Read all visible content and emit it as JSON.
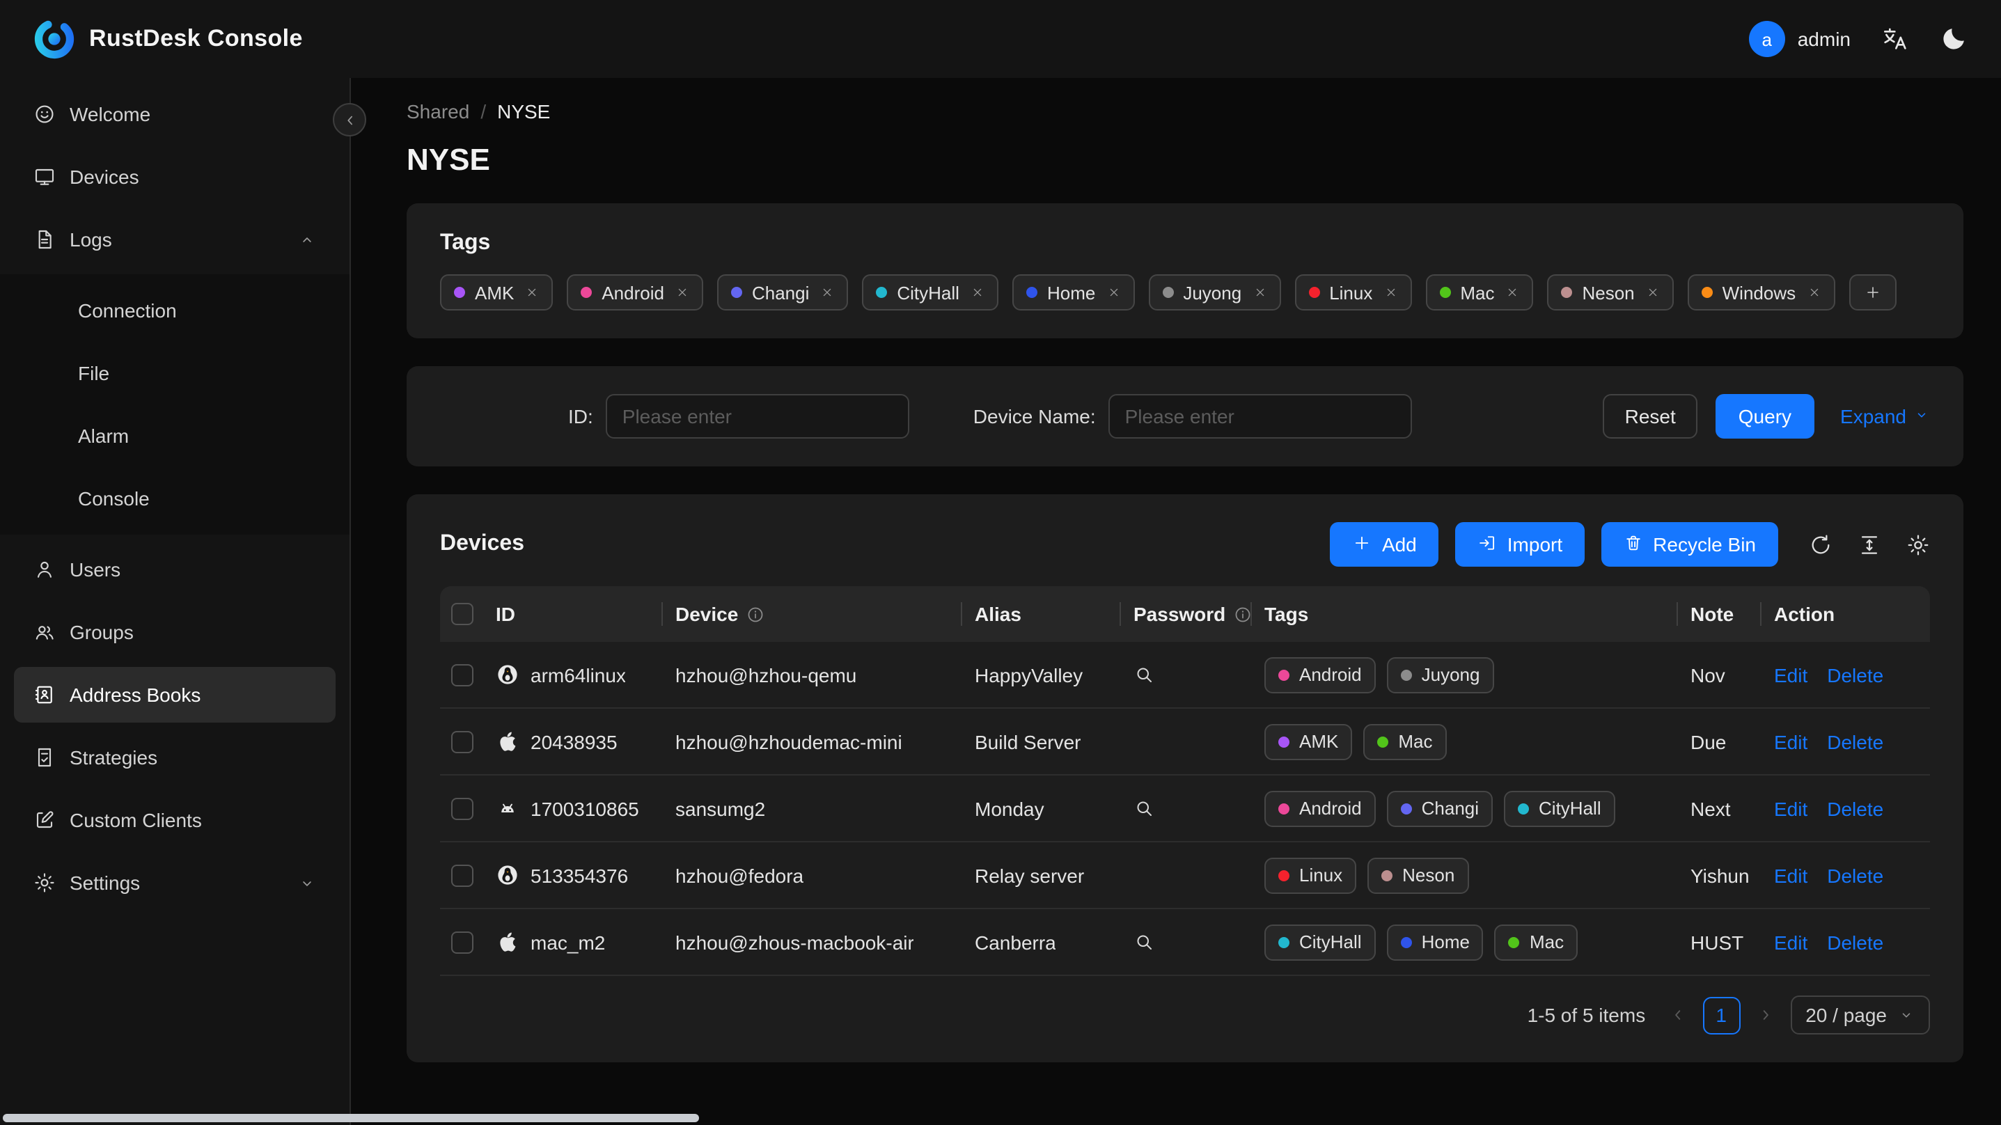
{
  "theme": {
    "accent_color": "#1677ff",
    "card_bg": "#1d1d1d",
    "page_bg": "#0a0a0a",
    "bar_bg": "#141414"
  },
  "header": {
    "app_title": "RustDesk Console",
    "user_initial": "a",
    "user_name": "admin"
  },
  "sidebar": {
    "items": [
      {
        "id": "welcome",
        "label": "Welcome",
        "icon": "smile-icon"
      },
      {
        "id": "devices",
        "label": "Devices",
        "icon": "desktop-icon"
      },
      {
        "id": "logs",
        "label": "Logs",
        "icon": "file-text-icon",
        "expanded": true,
        "children": [
          {
            "id": "connection",
            "label": "Connection"
          },
          {
            "id": "file",
            "label": "File"
          },
          {
            "id": "alarm",
            "label": "Alarm"
          },
          {
            "id": "console",
            "label": "Console"
          }
        ]
      },
      {
        "id": "users",
        "label": "Users",
        "icon": "user-icon"
      },
      {
        "id": "groups",
        "label": "Groups",
        "icon": "team-icon"
      },
      {
        "id": "address-books",
        "label": "Address Books",
        "icon": "contacts-icon",
        "active": true
      },
      {
        "id": "strategies",
        "label": "Strategies",
        "icon": "strategy-icon"
      },
      {
        "id": "custom-clients",
        "label": "Custom Clients",
        "icon": "form-icon"
      },
      {
        "id": "settings",
        "label": "Settings",
        "icon": "gear-icon",
        "collapsible": true
      }
    ]
  },
  "breadcrumb": {
    "parent": "Shared",
    "separator": "/",
    "current": "NYSE"
  },
  "page_title": "NYSE",
  "tag_colors": {
    "AMK": "#a855f7",
    "Android": "#ec4899",
    "Changi": "#6366f1",
    "CityHall": "#22b8cf",
    "Home": "#2f54eb",
    "Juyong": "#8c8c8c",
    "Linux": "#f5222d",
    "Mac": "#52c41a",
    "Neson": "#bc8f8f",
    "Windows": "#fa8c16"
  },
  "tags_card": {
    "title": "Tags",
    "tags": [
      "AMK",
      "Android",
      "Changi",
      "CityHall",
      "Home",
      "Juyong",
      "Linux",
      "Mac",
      "Neson",
      "Windows"
    ]
  },
  "filter": {
    "id_label": "ID:",
    "id_placeholder": "Please enter",
    "name_label": "Device Name:",
    "name_placeholder": "Please enter",
    "reset": "Reset",
    "query": "Query",
    "expand": "Expand"
  },
  "devices": {
    "title": "Devices",
    "buttons": {
      "add": "Add",
      "import": "Import",
      "recycle": "Recycle Bin"
    },
    "columns": [
      {
        "key": "id",
        "label": "ID"
      },
      {
        "key": "device",
        "label": "Device",
        "info": true
      },
      {
        "key": "alias",
        "label": "Alias"
      },
      {
        "key": "password",
        "label": "Password",
        "info": true
      },
      {
        "key": "tags",
        "label": "Tags"
      },
      {
        "key": "note",
        "label": "Note"
      },
      {
        "key": "action",
        "label": "Action"
      }
    ],
    "actions": {
      "edit": "Edit",
      "delete": "Delete"
    },
    "rows": [
      {
        "os": "linux",
        "id": "arm64linux",
        "device": "hzhou@hzhou-qemu",
        "alias": "HappyValley",
        "password_visible": true,
        "tags": [
          "Android",
          "Juyong"
        ],
        "note": "Nov"
      },
      {
        "os": "apple",
        "id": "20438935",
        "device": "hzhou@hzhoudemac-mini",
        "alias": "Build Server",
        "password_visible": false,
        "tags": [
          "AMK",
          "Mac"
        ],
        "note": "Due"
      },
      {
        "os": "android",
        "id": "1700310865",
        "device": "sansumg2",
        "alias": "Monday",
        "password_visible": true,
        "tags": [
          "Android",
          "Changi",
          "CityHall"
        ],
        "note": "Next"
      },
      {
        "os": "linux",
        "id": "513354376",
        "device": "hzhou@fedora",
        "alias": "Relay server",
        "password_visible": false,
        "tags": [
          "Linux",
          "Neson"
        ],
        "note": "Yishun"
      },
      {
        "os": "apple",
        "id": "mac_m2",
        "device": "hzhou@zhous-macbook-air",
        "alias": "Canberra",
        "password_visible": true,
        "tags": [
          "CityHall",
          "Home",
          "Mac"
        ],
        "note": "HUST"
      }
    ],
    "pagination": {
      "summary": "1-5 of 5 items",
      "page": "1",
      "page_size": "20 / page"
    }
  }
}
